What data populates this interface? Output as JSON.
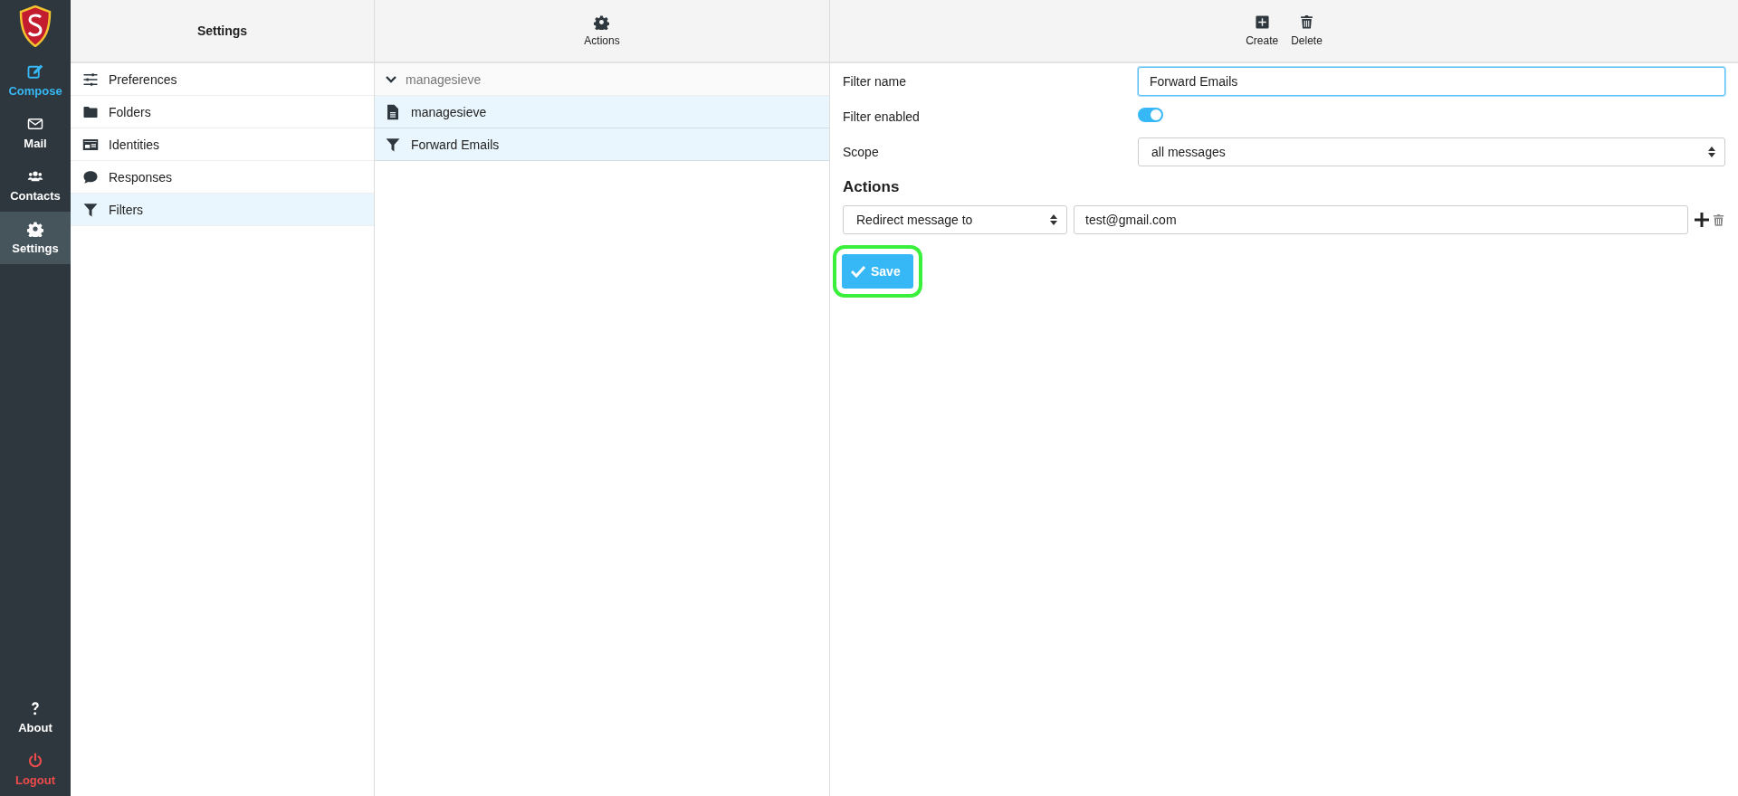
{
  "rail": {
    "items": [
      {
        "label": "Compose",
        "kind": "compose",
        "selected": false
      },
      {
        "label": "Mail",
        "kind": "mail",
        "selected": false
      },
      {
        "label": "Contacts",
        "kind": "users",
        "selected": false
      },
      {
        "label": "Settings",
        "kind": "gear",
        "selected": true
      }
    ],
    "bottom_items": [
      {
        "label": "About",
        "kind": "question",
        "selected": false
      },
      {
        "label": "Logout",
        "kind": "power",
        "selected": false
      }
    ]
  },
  "settings_panel": {
    "title": "Settings",
    "items": [
      {
        "label": "Preferences",
        "kind": "sliders",
        "selected": false
      },
      {
        "label": "Folders",
        "kind": "folder",
        "selected": false
      },
      {
        "label": "Identities",
        "kind": "idcard",
        "selected": false
      },
      {
        "label": "Responses",
        "kind": "comment",
        "selected": false
      },
      {
        "label": "Filters",
        "kind": "filter",
        "selected": true
      }
    ]
  },
  "middle_panel": {
    "toolbar": [
      {
        "label": "Actions",
        "kind": "gear"
      }
    ],
    "group": {
      "label": "managesieve",
      "expanded": true,
      "items": [
        {
          "label": "managesieve",
          "kind": "file",
          "selected": true
        },
        {
          "label": "Forward Emails",
          "kind": "filter",
          "selected": true
        }
      ]
    }
  },
  "editor": {
    "toolbar": [
      {
        "label": "Create",
        "kind": "plus-square"
      },
      {
        "label": "Delete",
        "kind": "trash"
      }
    ],
    "fields": [
      {
        "kind": "text",
        "label": "Filter name",
        "value": "Forward Emails",
        "focused": true
      },
      {
        "kind": "toggle",
        "label": "Filter enabled",
        "on": true
      },
      {
        "kind": "select",
        "label": "Scope",
        "value": "all messages"
      }
    ],
    "actions_heading": "Actions",
    "actions": [
      {
        "type": "Redirect message to",
        "value": "test@gmail.com"
      }
    ],
    "save": {
      "label": "Save",
      "highlighted": true
    }
  }
}
